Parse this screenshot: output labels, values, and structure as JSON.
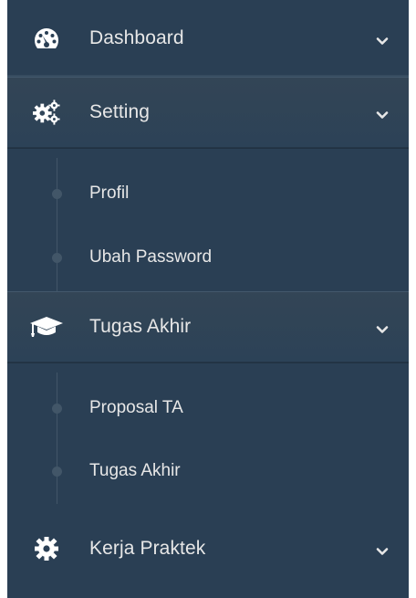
{
  "menu": {
    "dashboard": {
      "label": "Dashboard",
      "icon": "dashboard-gauge-icon"
    },
    "setting": {
      "label": "Setting",
      "icon": "cogs-icon",
      "expanded": true,
      "children": [
        {
          "label": "Profil"
        },
        {
          "label": "Ubah Password"
        }
      ]
    },
    "tugas_akhir": {
      "label": "Tugas Akhir",
      "icon": "graduation-cap-icon",
      "expanded": true,
      "children": [
        {
          "label": "Proposal TA"
        },
        {
          "label": "Tugas Akhir"
        }
      ]
    },
    "kerja_praktek": {
      "label": "Kerja Praktek",
      "icon": "cog-icon"
    }
  },
  "colors": {
    "sidebar_bg": "#2a3f54",
    "text": "#e7e7e7",
    "tree_line": "#425668"
  }
}
